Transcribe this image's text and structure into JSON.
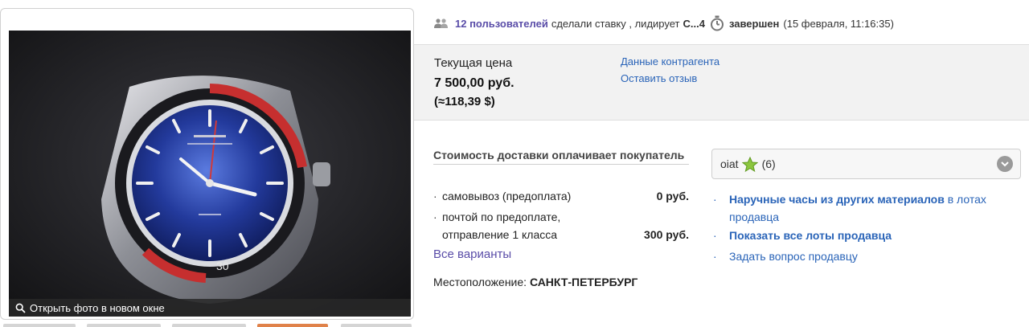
{
  "auction": {
    "bidders_link": "12 пользователей",
    "bid_text": "сделали ставку , лидирует",
    "leader": "С...4",
    "status": "завершен",
    "end_time": "(15 февраля, 11:16:35)"
  },
  "price": {
    "label": "Текущая цена",
    "value": "7 500,00 руб.",
    "usd": "(≈118,39 $)",
    "contragent_link": "Данные контрагента",
    "review_link": "Оставить отзыв"
  },
  "delivery": {
    "title": "Стоимость доставки оплачивает покупатель",
    "options": [
      {
        "name": "самовывоз (предоплата)",
        "price": "0 руб."
      },
      {
        "name_line1": "почтой по предоплате,",
        "name_line2": "отправление 1 класса",
        "price": "300 руб."
      }
    ],
    "all_variants": "Все варианты",
    "location_label": "Местоположение:",
    "location_city": "САНКТ-ПЕТЕРБУРГ"
  },
  "seller": {
    "name": "oiat",
    "rating": "(6)",
    "links": [
      {
        "strong": "Наручные часы из других материалов",
        "tail_line1": " в лотах",
        "tail_line2": "продавца"
      },
      {
        "strong": "Показать все лоты продавца"
      },
      {
        "text": "Задать вопрос продавцу"
      }
    ]
  },
  "photo": {
    "open_label": "Открыть фото в новом окне",
    "dial_number": "30"
  },
  "colors": {
    "accent_purple": "#5a4da8",
    "link_blue": "#2a64b8",
    "price_bg": "#f2f2f2",
    "star_green": "#8cc63f"
  },
  "icons": {
    "users": "users-icon",
    "timer": "stopwatch-icon",
    "star": "star-icon",
    "toggle": "chevron-down-icon",
    "search": "magnifier-icon"
  }
}
